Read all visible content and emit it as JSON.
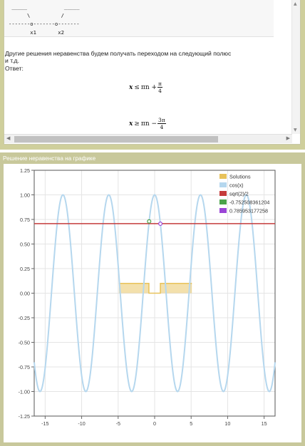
{
  "top_panel": {
    "ascii_art": [
      " _____            _____",
      "      \\          /",
      "-------ο-------ο-------",
      "       x1       x2"
    ],
    "text_lines": [
      "Другие решения неравенства будем получать переходом на следующий полюс",
      "и т.д.",
      "Ответ:"
    ],
    "formula1": {
      "var": "x",
      "op": "≤",
      "rhs": "πn +",
      "num": "π",
      "den": "4"
    },
    "formula2": {
      "var": "x",
      "op": "≥",
      "rhs": "πn −",
      "num": "3π",
      "den": "4"
    }
  },
  "graph_panel": {
    "title": "Решение неравенства на графике"
  },
  "chart_data": {
    "type": "line",
    "xlim": [
      -16.5,
      16.5
    ],
    "ylim": [
      -1.25,
      1.25
    ],
    "x_ticks": [
      -15,
      -10,
      -5,
      0,
      5,
      10,
      15
    ],
    "y_ticks": [
      -1.25,
      -1.0,
      -0.75,
      -0.5,
      -0.25,
      0.0,
      0.25,
      0.5,
      0.75,
      1.0,
      1.25
    ],
    "y_tick_labels": [
      "-1.25",
      "-1.00",
      "-0.75",
      "-0.50",
      "-0.25",
      "0.00",
      "0.25",
      "0.50",
      "0.75",
      "1.00",
      "1.25"
    ],
    "grid": true,
    "legend_position": "top-right",
    "colors": {
      "solutions": "#e8c25a",
      "cos": "#b5d7ee",
      "hline": "#c53b3b",
      "p1": "#4aa34a",
      "p2": "#9a45d6"
    },
    "series": [
      {
        "name": "Solutions",
        "kind": "step",
        "y_high": 0.1,
        "y_low": 0.0,
        "x_from": -4.9,
        "x_to": 5.1,
        "gaps": [
          [
            -0.7853981634,
            0.7853981634
          ]
        ]
      },
      {
        "name": "cos(x)",
        "kind": "function",
        "function": "cos"
      },
      {
        "name": "sqrt(2)/2",
        "kind": "hline",
        "y": 0.7071067812
      },
      {
        "name": "-0.752508361204",
        "kind": "point",
        "x": -0.752508361204,
        "y": 0.73
      },
      {
        "name": "0.785953177258",
        "kind": "point",
        "x": 0.785953177258,
        "y": 0.7064
      }
    ]
  }
}
